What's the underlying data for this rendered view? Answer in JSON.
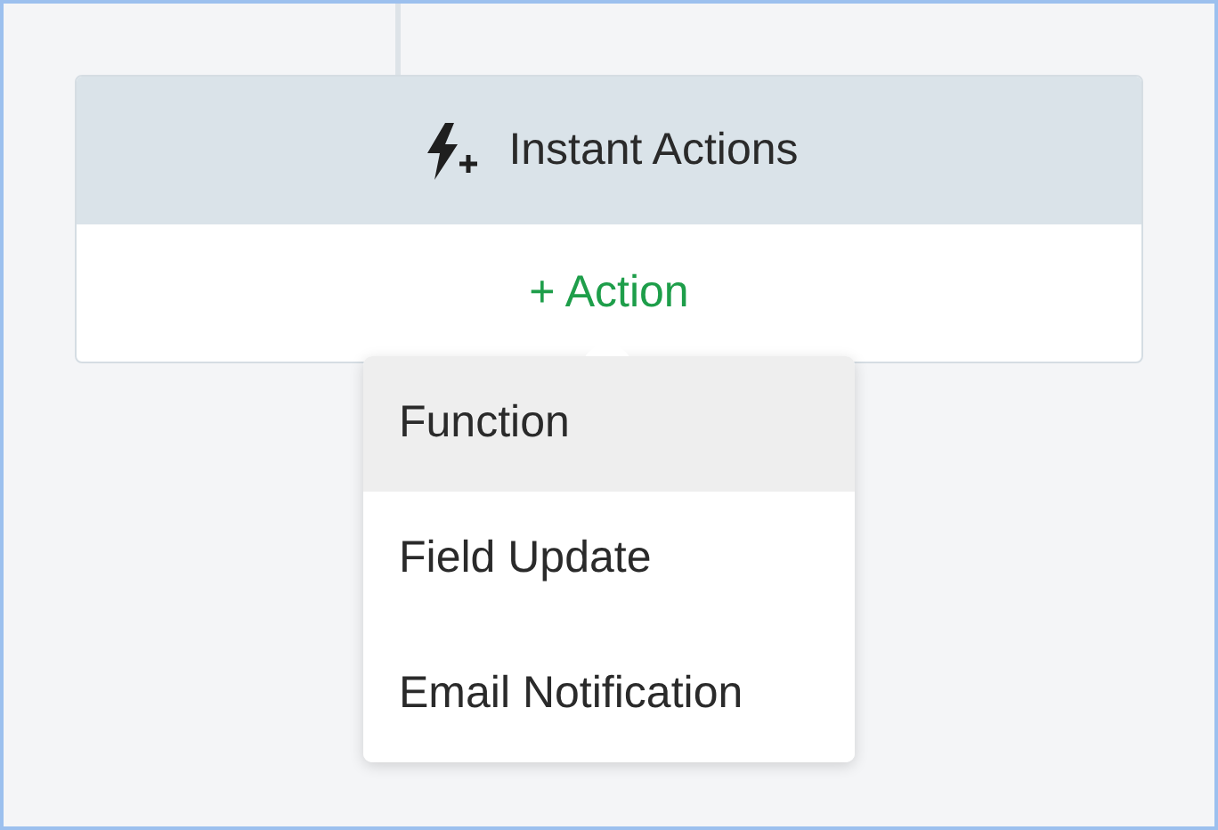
{
  "card": {
    "title": "Instant Actions",
    "add_action": "+ Action"
  },
  "menu": {
    "items": [
      {
        "label": "Function",
        "selected": true
      },
      {
        "label": "Field Update",
        "selected": false
      },
      {
        "label": "Email Notification",
        "selected": false
      }
    ]
  }
}
